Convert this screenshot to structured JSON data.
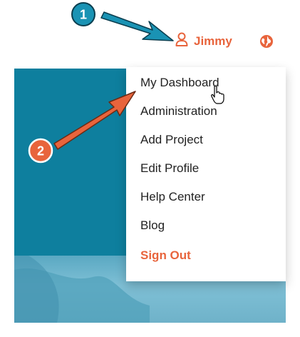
{
  "header": {
    "user_name": "Jimmy",
    "user_icon": "user-icon",
    "globe_icon": "globe-icon"
  },
  "menu": {
    "items": [
      {
        "label": "My Dashboard"
      },
      {
        "label": "Administration"
      },
      {
        "label": "Add Project"
      },
      {
        "label": "Edit Profile"
      },
      {
        "label": "Help Center"
      },
      {
        "label": "Blog"
      },
      {
        "label": "Sign Out"
      }
    ]
  },
  "annotations": {
    "step1": "1",
    "step2": "2"
  },
  "colors": {
    "accent": "#e8643c",
    "hero": "#0e7f9e",
    "callout_teal": "#1a93b4"
  }
}
